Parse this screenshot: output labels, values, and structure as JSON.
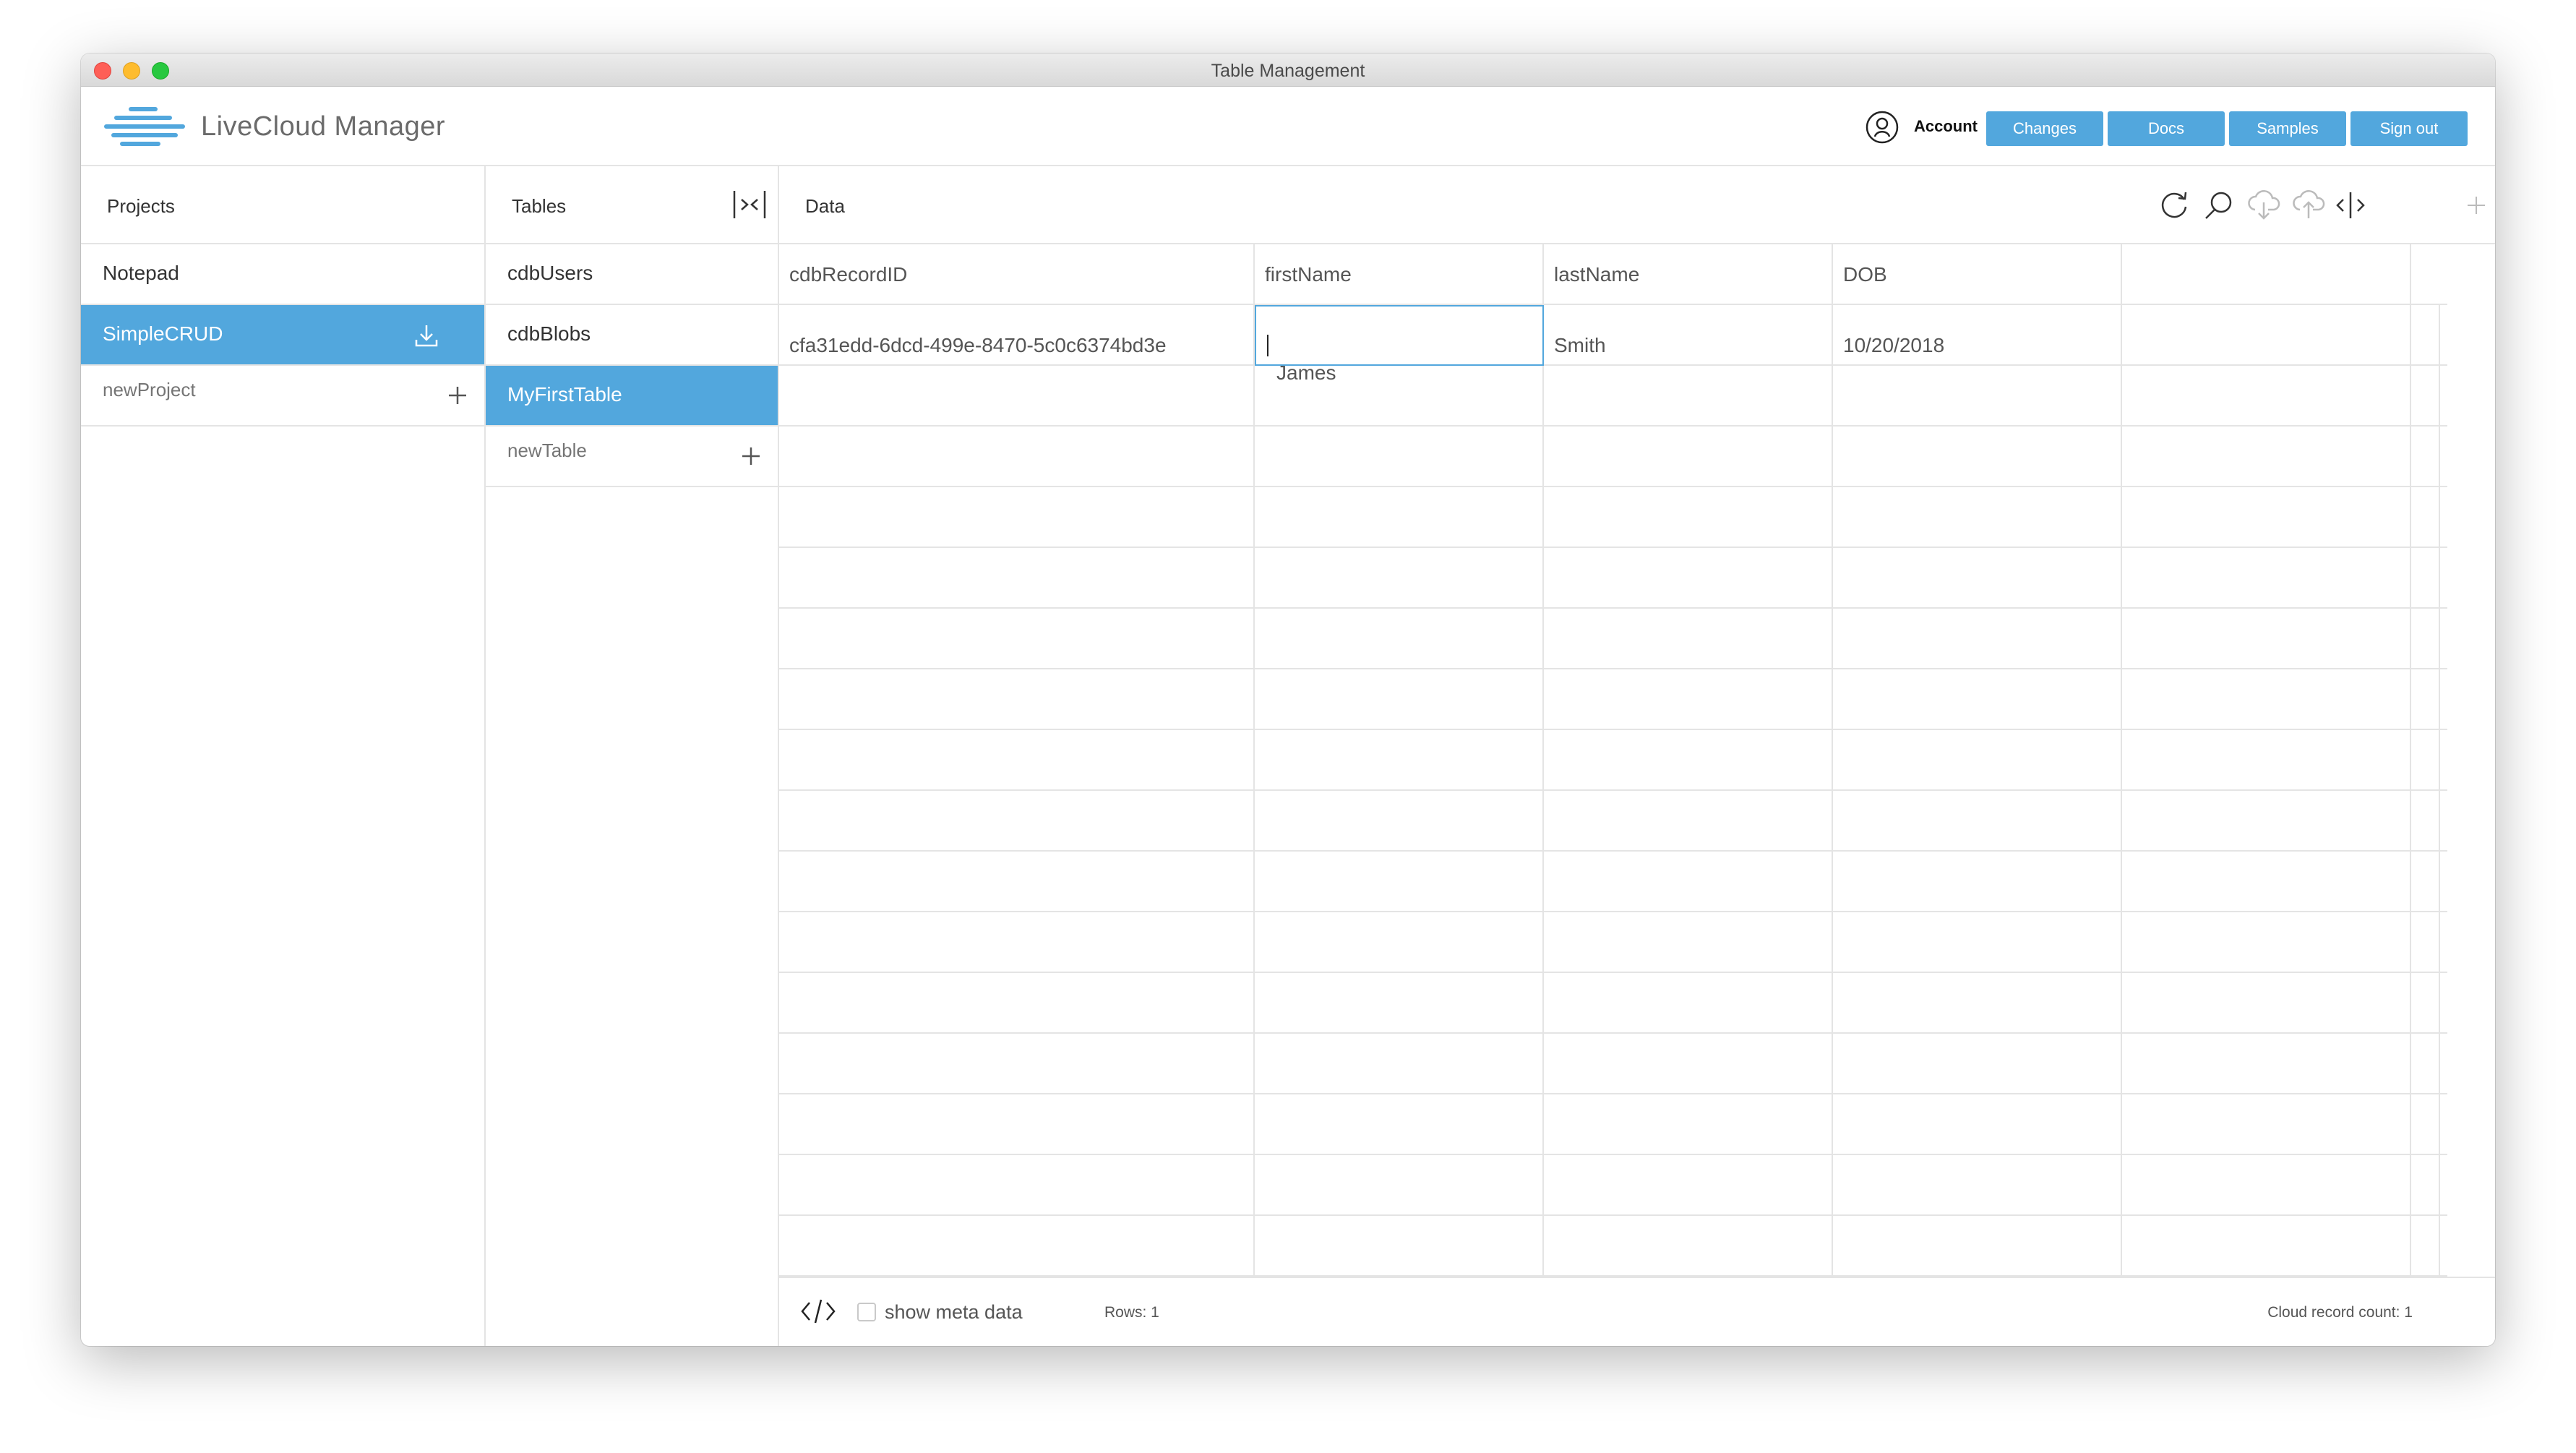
{
  "window": {
    "title": "Table Management"
  },
  "app": {
    "name": "LiveCloud Manager"
  },
  "header": {
    "account_label": "Account",
    "buttons": [
      "Changes",
      "Docs",
      "Samples",
      "Sign out"
    ]
  },
  "projects": {
    "title": "Projects",
    "items": [
      {
        "label": "Notepad",
        "selected": false
      },
      {
        "label": "SimpleCRUD",
        "selected": true
      }
    ],
    "new_placeholder": "newProject"
  },
  "tables": {
    "title": "Tables",
    "items": [
      {
        "label": "cdbUsers",
        "selected": false
      },
      {
        "label": "cdbBlobs",
        "selected": false
      },
      {
        "label": "MyFirstTable",
        "selected": true
      }
    ],
    "new_placeholder": "newTable"
  },
  "data": {
    "title": "Data",
    "columns": [
      "cdbRecordID",
      "firstName",
      "lastName",
      "DOB",
      ""
    ],
    "rows": [
      [
        "cfa31edd-6dcd-499e-8470-5c0c6374bd3e",
        "James",
        "Smith",
        "10/20/2018",
        ""
      ]
    ],
    "editing_cell": {
      "row": 0,
      "column": 1
    }
  },
  "footer": {
    "show_meta_label": "show meta data",
    "show_meta_checked": false,
    "rows_label": "Rows: 1",
    "cloud_count_label": "Cloud record count: 1"
  },
  "colors": {
    "accent": "#52a7dd",
    "divider": "#e4e4e4",
    "text": "#333333"
  }
}
